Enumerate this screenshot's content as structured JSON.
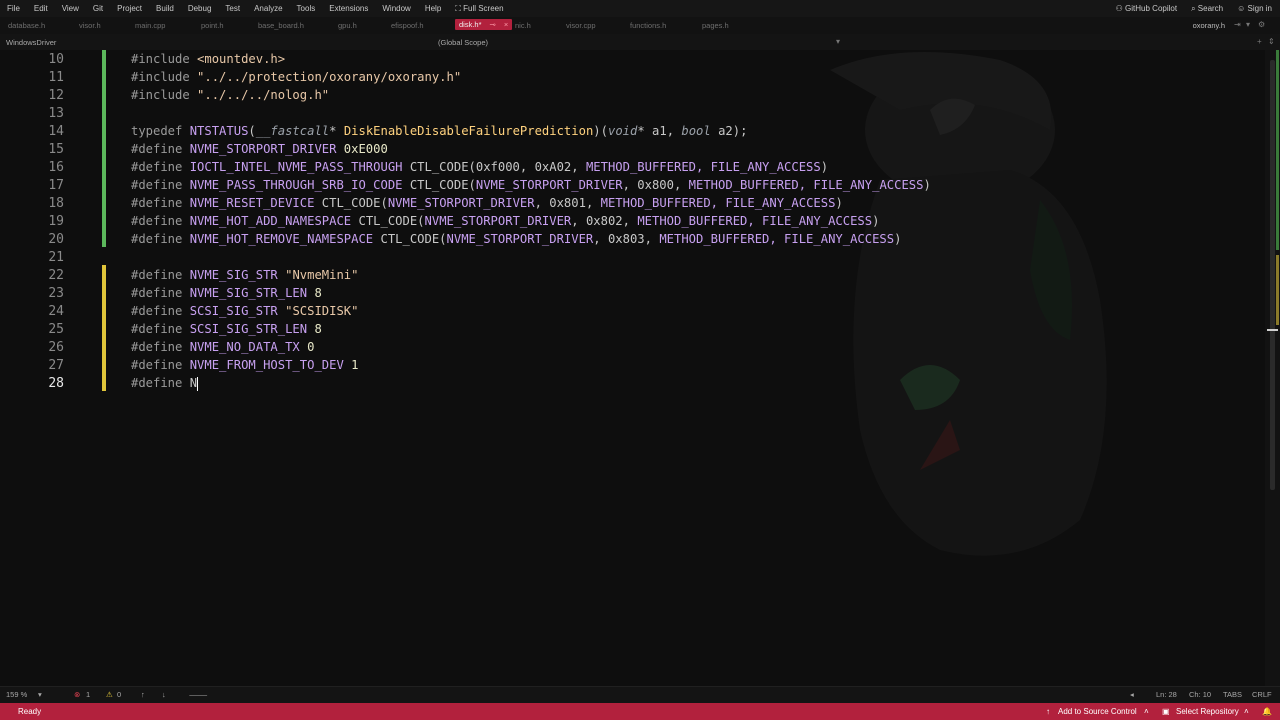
{
  "menu": [
    "File",
    "Edit",
    "View",
    "Git",
    "Project",
    "Build",
    "Debug",
    "Test",
    "Analyze",
    "Tools",
    "Extensions",
    "Window",
    "Help",
    "Full Screen"
  ],
  "menu_right": {
    "copilot": "GitHub Copilot",
    "search": "Search",
    "signin": "Sign in"
  },
  "tabs": [
    "database.h",
    "visor.h",
    "main.cpp",
    "point.h",
    "base_board.h",
    "gpu.h",
    "efispoof.h",
    "disk.h*",
    "nic.h",
    "visor.cpp",
    "functions.h",
    "pages.h"
  ],
  "active_tab_close": "×",
  "right_file": "oxorany.h",
  "nav": {
    "project": "WindowsDriver",
    "scope": "(Global Scope)"
  },
  "lines": [
    "10",
    "11",
    "12",
    "13",
    "14",
    "15",
    "16",
    "17",
    "18",
    "19",
    "20",
    "21",
    "22",
    "23",
    "24",
    "25",
    "26",
    "27",
    "28"
  ],
  "code": {
    "l10a": "#include ",
    "l10b": "<mountdev.h>",
    "l11a": "#include ",
    "l11b": "\"../../protection/oxorany/oxorany.h\"",
    "l12a": "#include ",
    "l12b": "\"../../../nolog.h\"",
    "l14a": "typedef ",
    "l14b": "NTSTATUS",
    "l14c": "(",
    "l14d": "__fastcall",
    "l14e": "* ",
    "l14f": "DiskEnableDisableFailurePrediction",
    "l14g": ")(",
    "l14h": "void",
    "l14i": "* a1, ",
    "l14j": "bool",
    "l14k": " a2);",
    "l15a": "#define ",
    "l15b": "NVME_STORPORT_DRIVER",
    "l15c": " 0xE000",
    "l16a": "#define ",
    "l16b": "IOCTL_INTEL_NVME_PASS_THROUGH",
    "l16c": " CTL_CODE(0xf000, 0xA02, ",
    "l16d": "METHOD_BUFFERED, FILE_ANY_ACCESS",
    ")": ")",
    "l16e": ")",
    "l17a": "#define ",
    "l17b": "NVME_PASS_THROUGH_SRB_IO_CODE",
    "l17c": " CTL_CODE(",
    "l17d": "NVME_STORPORT_DRIVER",
    "l17e": ", 0x800, ",
    "l17f": "METHOD_BUFFERED, FILE_ANY_ACCESS",
    "l17g": ")",
    "l18a": "#define ",
    "l18b": "NVME_RESET_DEVICE",
    "l18c": " CTL_CODE(",
    "l18d": "NVME_STORPORT_DRIVER",
    "l18e": ", 0x801, ",
    "l18f": "METHOD_BUFFERED, FILE_ANY_ACCESS",
    "l18g": ")",
    "l19a": "#define ",
    "l19b": "NVME_HOT_ADD_NAMESPACE",
    "l19c": " CTL_CODE(",
    "l19d": "NVME_STORPORT_DRIVER",
    "l19e": ", 0x802, ",
    "l19f": "METHOD_BUFFERED, FILE_ANY_ACCESS",
    "l19g": ")",
    "l20a": "#define ",
    "l20b": "NVME_HOT_REMOVE_NAMESPACE",
    "l20c": " CTL_CODE(",
    "l20d": "NVME_STORPORT_DRIVER",
    "l20e": ", 0x803, ",
    "l20f": "METHOD_BUFFERED, FILE_ANY_ACCESS",
    "l20g": ")",
    "l22a": "#define ",
    "l22b": "NVME_SIG_STR",
    "l22c": " \"NvmeMini\"",
    "l23a": "#define ",
    "l23b": "NVME_SIG_STR_LEN",
    "l23c": " 8",
    "l24a": "#define ",
    "l24b": "SCSI_SIG_STR",
    "l24c": " \"SCSIDISK\"",
    "l25a": "#define ",
    "l25b": "SCSI_SIG_STR_LEN",
    "l25c": " 8",
    "l26a": "#define ",
    "l26b": "NVME_NO_DATA_TX",
    "l26c": " 0",
    "l27a": "#define ",
    "l27b": "NVME_FROM_HOST_TO_DEV",
    "l27c": " 1",
    "l28a": "#define ",
    "l28b": "N"
  },
  "editor_status": {
    "zoom": "159 %",
    "errors": "1",
    "warnings": "0",
    "ln": "Ln: 28",
    "ch": "Ch: 10",
    "tabs": "TABS",
    "eol": "CRLF"
  },
  "status": {
    "ready": "Ready",
    "source": "Add to Source Control",
    "repo": "Select Repository"
  },
  "colors": {
    "accent": "#b2213d",
    "bar_added": "#5cb85c",
    "bar_modified": "#e0c53a"
  }
}
